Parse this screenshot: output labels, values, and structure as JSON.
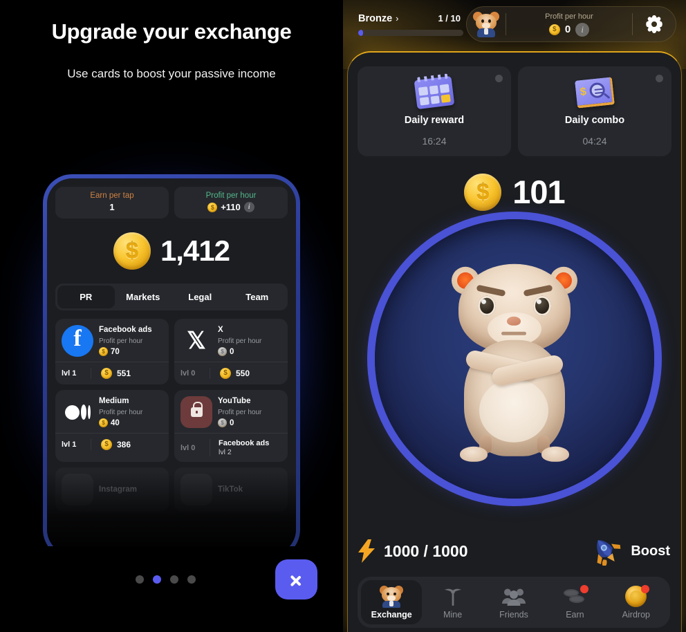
{
  "promo": {
    "title": "Upgrade your exchange",
    "subtitle": "Use cards to boost your passive income",
    "next_label": "next-slide",
    "dots_total": 4,
    "active_dot": 2
  },
  "phone_preview": {
    "stats": {
      "earn_per_tap_label": "Earn per tap",
      "earn_per_tap_value": "1",
      "profit_per_hour_label": "Profit per hour",
      "profit_per_hour_value": "+110",
      "info_glyph": "i"
    },
    "balance": "1,412",
    "coin_glyph": "$",
    "tabs": [
      {
        "label": "PR",
        "active": true
      },
      {
        "label": "Markets",
        "active": false
      },
      {
        "label": "Legal",
        "active": false
      },
      {
        "label": "Team",
        "active": false
      }
    ],
    "cards": [
      {
        "name": "Facebook ads",
        "icon": "facebook-icon",
        "pph_label": "Profit per hour",
        "pph_value": "70",
        "level": "lvl 1",
        "price": "551",
        "locked": false
      },
      {
        "name": "X",
        "icon": "x-icon",
        "pph_label": "Profit per hour",
        "pph_value": "0",
        "level": "lvl 0",
        "price": "550",
        "locked": false
      },
      {
        "name": "Medium",
        "icon": "medium-icon",
        "pph_label": "Profit per hour",
        "pph_value": "40",
        "level": "lvl 1",
        "price": "386",
        "locked": false
      },
      {
        "name": "YouTube",
        "icon": "lock-icon",
        "pph_label": "Profit per hour",
        "pph_value": "0",
        "level": "lvl 0",
        "requirement_name": "Facebook ads",
        "requirement_level": "lvl 2",
        "locked": true
      }
    ],
    "faded_cards": [
      {
        "name": "Instagram"
      },
      {
        "name": "TikTok"
      }
    ]
  },
  "app": {
    "header": {
      "rank_name": "Bronze",
      "rank_chevron": "›",
      "rank_progress": "1 / 10",
      "profit_per_hour_label": "Profit per hour",
      "profit_per_hour_value": "0",
      "info_glyph": "i",
      "settings_icon": "gear-icon",
      "avatar_icon": "hamster-avatar"
    },
    "daily": [
      {
        "title": "Daily reward",
        "time": "16:24",
        "icon": "calendar-icon"
      },
      {
        "title": "Daily combo",
        "time": "04:24",
        "icon": "combo-card-icon"
      }
    ],
    "balance": "101",
    "coin_glyph": "$",
    "tapper": {
      "character": "hamster-character"
    },
    "energy": {
      "icon": "lightning-bolt-icon",
      "value": "1000 / 1000"
    },
    "boost": {
      "label": "Boost",
      "icon": "rocket-icon"
    },
    "nav": [
      {
        "label": "Exchange",
        "icon": "hamster-icon",
        "active": true,
        "badge": false
      },
      {
        "label": "Mine",
        "icon": "pickaxe-icon",
        "active": false,
        "badge": false
      },
      {
        "label": "Friends",
        "icon": "friends-icon",
        "active": false,
        "badge": false
      },
      {
        "label": "Earn",
        "icon": "coins-icon",
        "active": false,
        "badge": true
      },
      {
        "label": "Airdrop",
        "icon": "gold-coin-icon",
        "active": false,
        "badge": true
      }
    ]
  },
  "colors": {
    "accent_blue": "#5a5cf0",
    "gold": "#e0a51a",
    "coin_yellow": "#f9c52f",
    "panel": "#1b1d21",
    "card": "#26282d",
    "muted_text": "#8d9097",
    "badge_red": "#ef3d2e",
    "earn_label": "#d08243",
    "profit_label": "#53b98a"
  }
}
